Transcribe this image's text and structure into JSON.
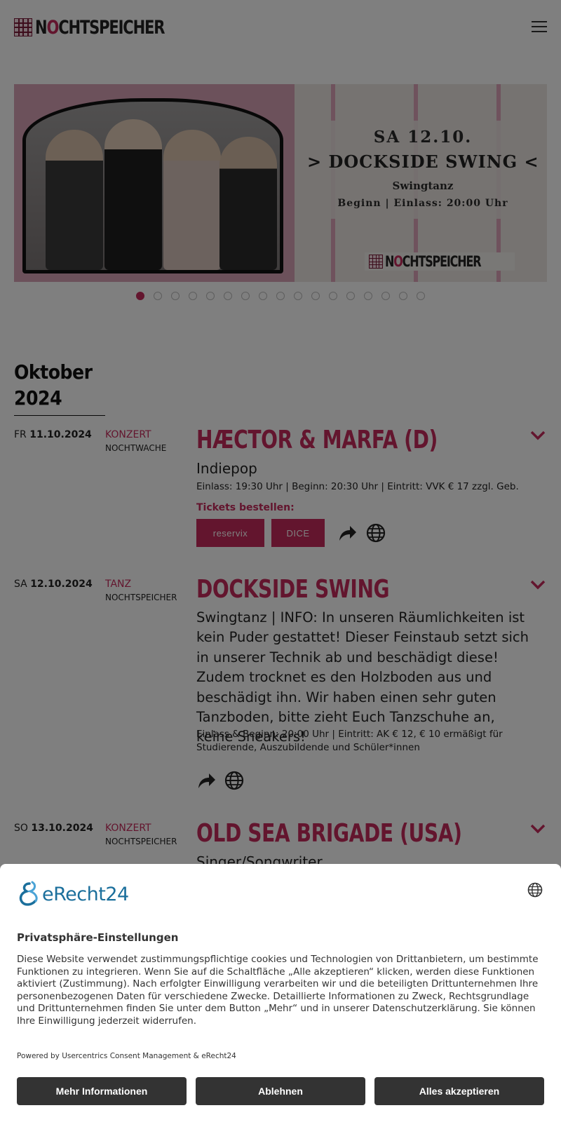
{
  "header": {
    "logo_text_prefix": "N",
    "logo_text_accent": "O",
    "logo_text_rest": "CHTSPEICHER"
  },
  "slider": {
    "slide_date": "SA 12.10.",
    "slide_title": "> DOCKSIDE SWING <",
    "slide_subtitle": "Swingtanz",
    "slide_time": "Beginn | Einlass: 20:00 Uhr",
    "slide_logo_prefix": "N",
    "slide_logo_accent": "O",
    "slide_logo_rest": "CHTSPEICHER",
    "slide_count": 17,
    "active_slide": 1
  },
  "month": {
    "label_line1": "Oktober",
    "label_line2": "2024"
  },
  "events": [
    {
      "weekday": "FR",
      "date": "11.10.2024",
      "category": "KONZERT",
      "venue": "NOCHTWACHE",
      "title": "HÆCTOR & MARFA (D)",
      "genre": "Indiepop",
      "info": "Einlass: 19:30 Uhr | Beginn: 20:30 Uhr | Eintritt: VVK € 17 zzgl. Geb.",
      "tickets_label": "Tickets bestellen:",
      "ticket_buttons": [
        "reservix",
        "DICE"
      ]
    },
    {
      "weekday": "SA",
      "date": "12.10.2024",
      "category": "TANZ",
      "venue": "NOCHTSPEICHER",
      "title": "DOCKSIDE SWING",
      "genre": "Swingtanz | INFO: In unseren Räumlichkeiten ist kein Puder gestattet! Dieser Feinstaub setzt sich in unserer Technik ab und beschädigt diese! Zudem trocknet es den Holzboden aus und beschädigt ihn. Wir haben einen sehr guten Tanzboden, bitte zieht Euch Tanzschuhe an, keine Sneakers!",
      "info": "Einlass & Beginn: 20:00 Uhr | Eintritt: AK € 12, € 10 ermäßigt für Studierende, Auszubildende und Schüler*innen"
    },
    {
      "weekday": "SO",
      "date": "13.10.2024",
      "category": "KONZERT",
      "venue": "NOCHTSPEICHER",
      "title": "OLD SEA BRIGADE (USA)",
      "genre": "Singer/Songwriter"
    }
  ],
  "consent": {
    "brand": "eRecht24",
    "title": "Privatsphäre-Einstellungen",
    "text": "Diese Website verwendet zustimmungspflichtige cookies und Technologien von Drittanbietern, um bestimmte Funktionen zu integrieren. Wenn Sie auf die Schaltfläche „Alle akzeptieren“ klicken, werden diese Funktionen aktiviert (Zustimmung). Nach erfolgter Einwilligung verarbeiten wir und die beteiligten Drittunternehmen Ihre personenbezogenen Daten für verschiedene Zwecke. Detaillierte Informationen zu Zweck, Rechtsgrundlage und Drittunternehmen finden Sie unter dem Button „Mehr“ und in unserer Datenschutzerklärung. Sie können Ihre Einwilligung jederzeit widerrufen.",
    "powered_by": "Powered by Usercentrics Consent Management & eRecht24",
    "more_button": "Mehr Informationen",
    "deny_button": "Ablehnen",
    "accept_button": "Alles akzeptieren"
  },
  "colors": {
    "accent": "#c62b5c",
    "consent_button": "#333333",
    "erecht_blue": "#1b6f9c"
  },
  "icons": [
    "menu-icon",
    "chevron-down-icon",
    "share-icon",
    "globe-icon",
    "language-globe-icon",
    "erecht24-logo-icon"
  ]
}
